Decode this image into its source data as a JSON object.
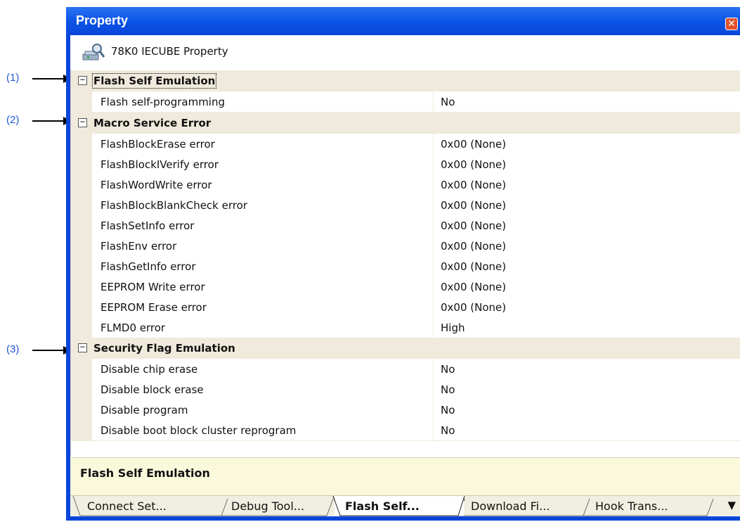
{
  "callouts": [
    {
      "label": "(1)"
    },
    {
      "label": "(2)"
    },
    {
      "label": "(3)"
    }
  ],
  "window": {
    "title": "Property",
    "close_icon": "close-icon"
  },
  "header": {
    "icon": "property-tool-icon",
    "text": "78K0 IECUBE Property"
  },
  "categories": [
    {
      "label": "Flash Self Emulation",
      "toggle": "⊟",
      "items": [
        {
          "name": "Flash self-programming",
          "value": "No"
        }
      ]
    },
    {
      "label": "Macro Service Error",
      "toggle": "⊟",
      "items": [
        {
          "name": "FlashBlockErase error",
          "value": "0x00 (None)"
        },
        {
          "name": "FlashBlockIVerify error",
          "value": "0x00 (None)"
        },
        {
          "name": "FlashWordWrite error",
          "value": "0x00 (None)"
        },
        {
          "name": "FlashBlockBlankCheck error",
          "value": "0x00 (None)"
        },
        {
          "name": "FlashSetInfo error",
          "value": "0x00 (None)"
        },
        {
          "name": "FlashEnv error",
          "value": "0x00 (None)"
        },
        {
          "name": "FlashGetInfo error",
          "value": "0x00 (None)"
        },
        {
          "name": "EEPROM Write error",
          "value": "0x00 (None)"
        },
        {
          "name": "EEPROM Erase error",
          "value": "0x00 (None)"
        },
        {
          "name": "FLMD0 error",
          "value": "High"
        }
      ]
    },
    {
      "label": "Security Flag Emulation",
      "toggle": "⊟",
      "items": [
        {
          "name": "Disable chip erase",
          "value": "No"
        },
        {
          "name": "Disable block erase",
          "value": "No"
        },
        {
          "name": "Disable program",
          "value": "No"
        },
        {
          "name": "Disable boot block cluster reprogram",
          "value": "No"
        }
      ]
    }
  ],
  "description": "Flash Self Emulation",
  "tabs": [
    {
      "label": "Connect Set...",
      "active": false
    },
    {
      "label": "Debug Tool...",
      "active": false
    },
    {
      "label": "Flash  Self...",
      "active": true
    },
    {
      "label": "Download Fi...",
      "active": false
    },
    {
      "label": "Hook Trans...",
      "active": false
    }
  ],
  "tab_overflow": "▼",
  "colors": {
    "titlebar": "#0a52e6",
    "category_bg": "#efeadc",
    "description_bg": "#fbf9dc",
    "callout": "#1f5bd6"
  }
}
